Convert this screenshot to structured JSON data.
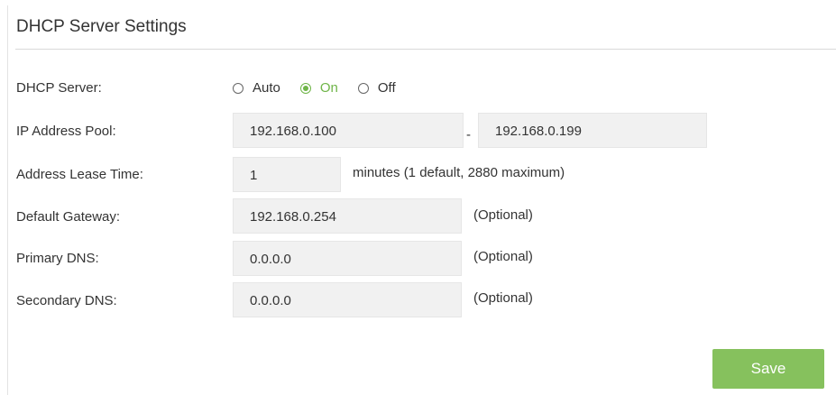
{
  "section": {
    "title": "DHCP Server Settings"
  },
  "dhcp_server": {
    "label": "DHCP Server:",
    "options": [
      "Auto",
      "On",
      "Off"
    ],
    "selected": "On"
  },
  "ip_pool": {
    "label": "IP Address Pool:",
    "start": "192.168.0.100",
    "separator": "-",
    "end": "192.168.0.199"
  },
  "lease_time": {
    "label": "Address Lease Time:",
    "value": "1",
    "hint": "minutes (1 default, 2880 maximum)"
  },
  "gateway": {
    "label": "Default Gateway:",
    "value": "192.168.0.254",
    "hint": "(Optional)"
  },
  "primary_dns": {
    "label": "Primary DNS:",
    "value": "0.0.0.0",
    "hint": "(Optional)"
  },
  "secondary_dns": {
    "label": "Secondary DNS:",
    "value": "0.0.0.0",
    "hint": "(Optional)"
  },
  "actions": {
    "save_label": "Save"
  },
  "colors": {
    "accent": "#6fb548",
    "button": "#86c15d",
    "field_bg": "#f1f1f1"
  }
}
